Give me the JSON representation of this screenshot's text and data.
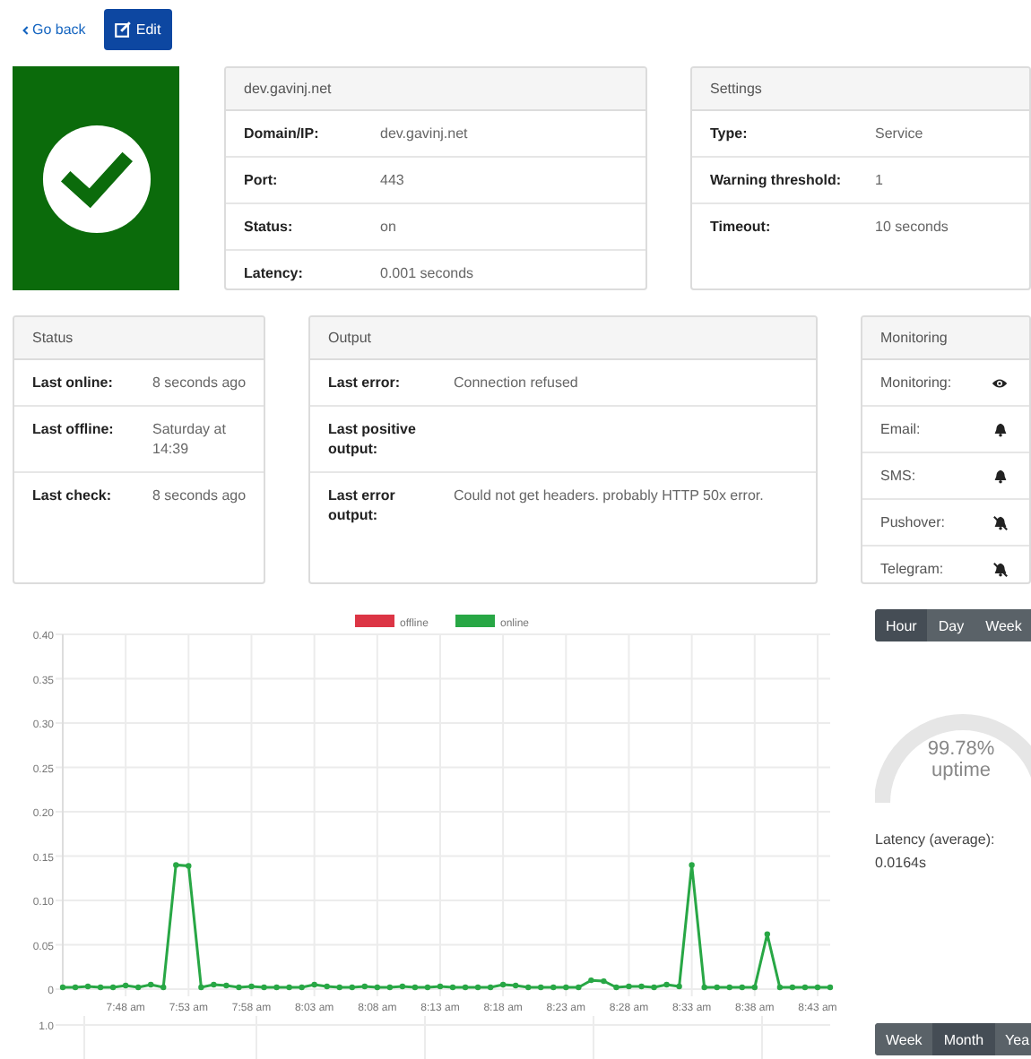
{
  "toolbar": {
    "back_link": "Go back",
    "edit_button": "Edit"
  },
  "status_tile": {
    "up": true
  },
  "host_card": {
    "title": "dev.gavinj.net",
    "rows": [
      {
        "label": "Domain/IP:",
        "value": "dev.gavinj.net"
      },
      {
        "label": "Port:",
        "value": "443"
      },
      {
        "label": "Status:",
        "value": "on"
      },
      {
        "label": "Latency:",
        "value": "0.001 seconds"
      }
    ]
  },
  "settings_card": {
    "title": "Settings",
    "rows": [
      {
        "label": "Type:",
        "value": "Service"
      },
      {
        "label": "Warning threshold:",
        "value": "1"
      },
      {
        "label": "Timeout:",
        "value": "10 seconds"
      }
    ]
  },
  "status_card": {
    "title": "Status",
    "rows": [
      {
        "label": "Last online:",
        "value": "8 seconds ago"
      },
      {
        "label": "Last offline:",
        "value": "Saturday at 14:39"
      },
      {
        "label": "Last check:",
        "value": "8 seconds ago"
      }
    ]
  },
  "output_card": {
    "title": "Output",
    "rows": [
      {
        "label": "Last error:",
        "value": "Connection refused"
      },
      {
        "label": "Last positive output:"
      },
      {
        "label": "Last error output:",
        "value": "Could not get headers. probably HTTP 50x error."
      }
    ]
  },
  "monitoring_card": {
    "title": "Monitoring",
    "rows": [
      {
        "label": "Monitoring:",
        "kind": "eye",
        "on": true
      },
      {
        "label": "Email:",
        "kind": "bell",
        "on": true
      },
      {
        "label": "SMS:",
        "kind": "bell",
        "on": true
      },
      {
        "label": "Pushover:",
        "kind": "bell",
        "on": false
      },
      {
        "label": "Telegram:",
        "kind": "bell",
        "on": false
      }
    ]
  },
  "latency_chart": {
    "chart_data": {
      "type": "line",
      "grid": true,
      "ylim": [
        0,
        0.4
      ],
      "categories": [
        null,
        null,
        null,
        null,
        null,
        "7:48 am",
        null,
        null,
        null,
        null,
        "7:53 am",
        null,
        null,
        null,
        null,
        "7:58 am",
        null,
        null,
        null,
        null,
        "8:03 am",
        null,
        null,
        null,
        null,
        "8:08 am",
        null,
        null,
        null,
        null,
        "8:13 am",
        null,
        null,
        null,
        null,
        "8:18 am",
        null,
        null,
        null,
        null,
        "8:23 am",
        null,
        null,
        null,
        null,
        "8:28 am",
        null,
        null,
        null,
        null,
        "8:33 am",
        null,
        null,
        null,
        null,
        "8:38 am",
        null,
        null,
        null,
        null,
        "8:43 am",
        null
      ],
      "yticks": [
        {
          "value": 0,
          "label": "0"
        },
        {
          "value": 0.05,
          "label": "0.05"
        },
        {
          "value": 0.1,
          "label": "0.10"
        },
        {
          "value": 0.15,
          "label": "0.15"
        },
        {
          "value": 0.2,
          "label": "0.20"
        },
        {
          "value": 0.25,
          "label": "0.25"
        },
        {
          "value": 0.3,
          "label": "0.30"
        },
        {
          "value": 0.35,
          "label": "0.35"
        },
        {
          "value": 0.4,
          "label": "0.40"
        }
      ],
      "series": [
        {
          "name": "offline",
          "color": "#dc3545",
          "values": [
            null,
            null,
            null,
            null,
            null,
            null,
            null,
            null,
            null,
            null,
            null,
            null,
            null,
            null,
            null,
            null,
            null,
            null,
            null,
            null,
            null,
            null,
            null,
            null,
            null,
            null,
            null,
            null,
            null,
            null,
            null,
            null,
            null,
            null,
            null,
            null,
            null,
            null,
            null,
            null,
            null,
            null,
            null,
            null,
            null,
            null,
            null,
            null,
            null,
            null,
            null,
            null,
            null,
            null,
            null,
            null,
            null,
            null,
            null,
            null,
            null,
            null
          ]
        },
        {
          "name": "online",
          "color": "#28a745",
          "marker": "circle",
          "values": [
            0.002,
            0.002,
            0.003,
            0.002,
            0.002,
            0.004,
            0.002,
            0.005,
            0.002,
            0.14,
            0.139,
            0.002,
            0.005,
            0.004,
            0.002,
            0.003,
            0.002,
            0.002,
            0.002,
            0.002,
            0.005,
            0.003,
            0.002,
            0.002,
            0.003,
            0.002,
            0.002,
            0.003,
            0.002,
            0.002,
            0.003,
            0.002,
            0.002,
            0.002,
            0.002,
            0.005,
            0.004,
            0.002,
            0.002,
            0.002,
            0.002,
            0.002,
            0.01,
            0.009,
            0.002,
            0.003,
            0.003,
            0.002,
            0.005,
            0.003,
            0.14,
            0.002,
            0.002,
            0.002,
            0.002,
            0.002,
            0.062,
            0.002,
            0.002,
            0.002,
            0.002,
            0.002
          ]
        }
      ]
    }
  },
  "uptime_chart": {
    "top_tick": "1.0"
  },
  "range_buttons": [
    {
      "label": "Hour",
      "selected": true
    },
    {
      "label": "Day",
      "selected": false
    },
    {
      "label": "Week",
      "selected": false
    }
  ],
  "uptime": {
    "percent": "99.78%",
    "caption": "uptime"
  },
  "latency_average": {
    "label": "Latency (average):",
    "value": "0.0164s"
  },
  "history_buttons": [
    {
      "label": "Week",
      "selected": false
    },
    {
      "label": "Month",
      "selected": true
    },
    {
      "label": "Yea",
      "selected": false
    }
  ]
}
